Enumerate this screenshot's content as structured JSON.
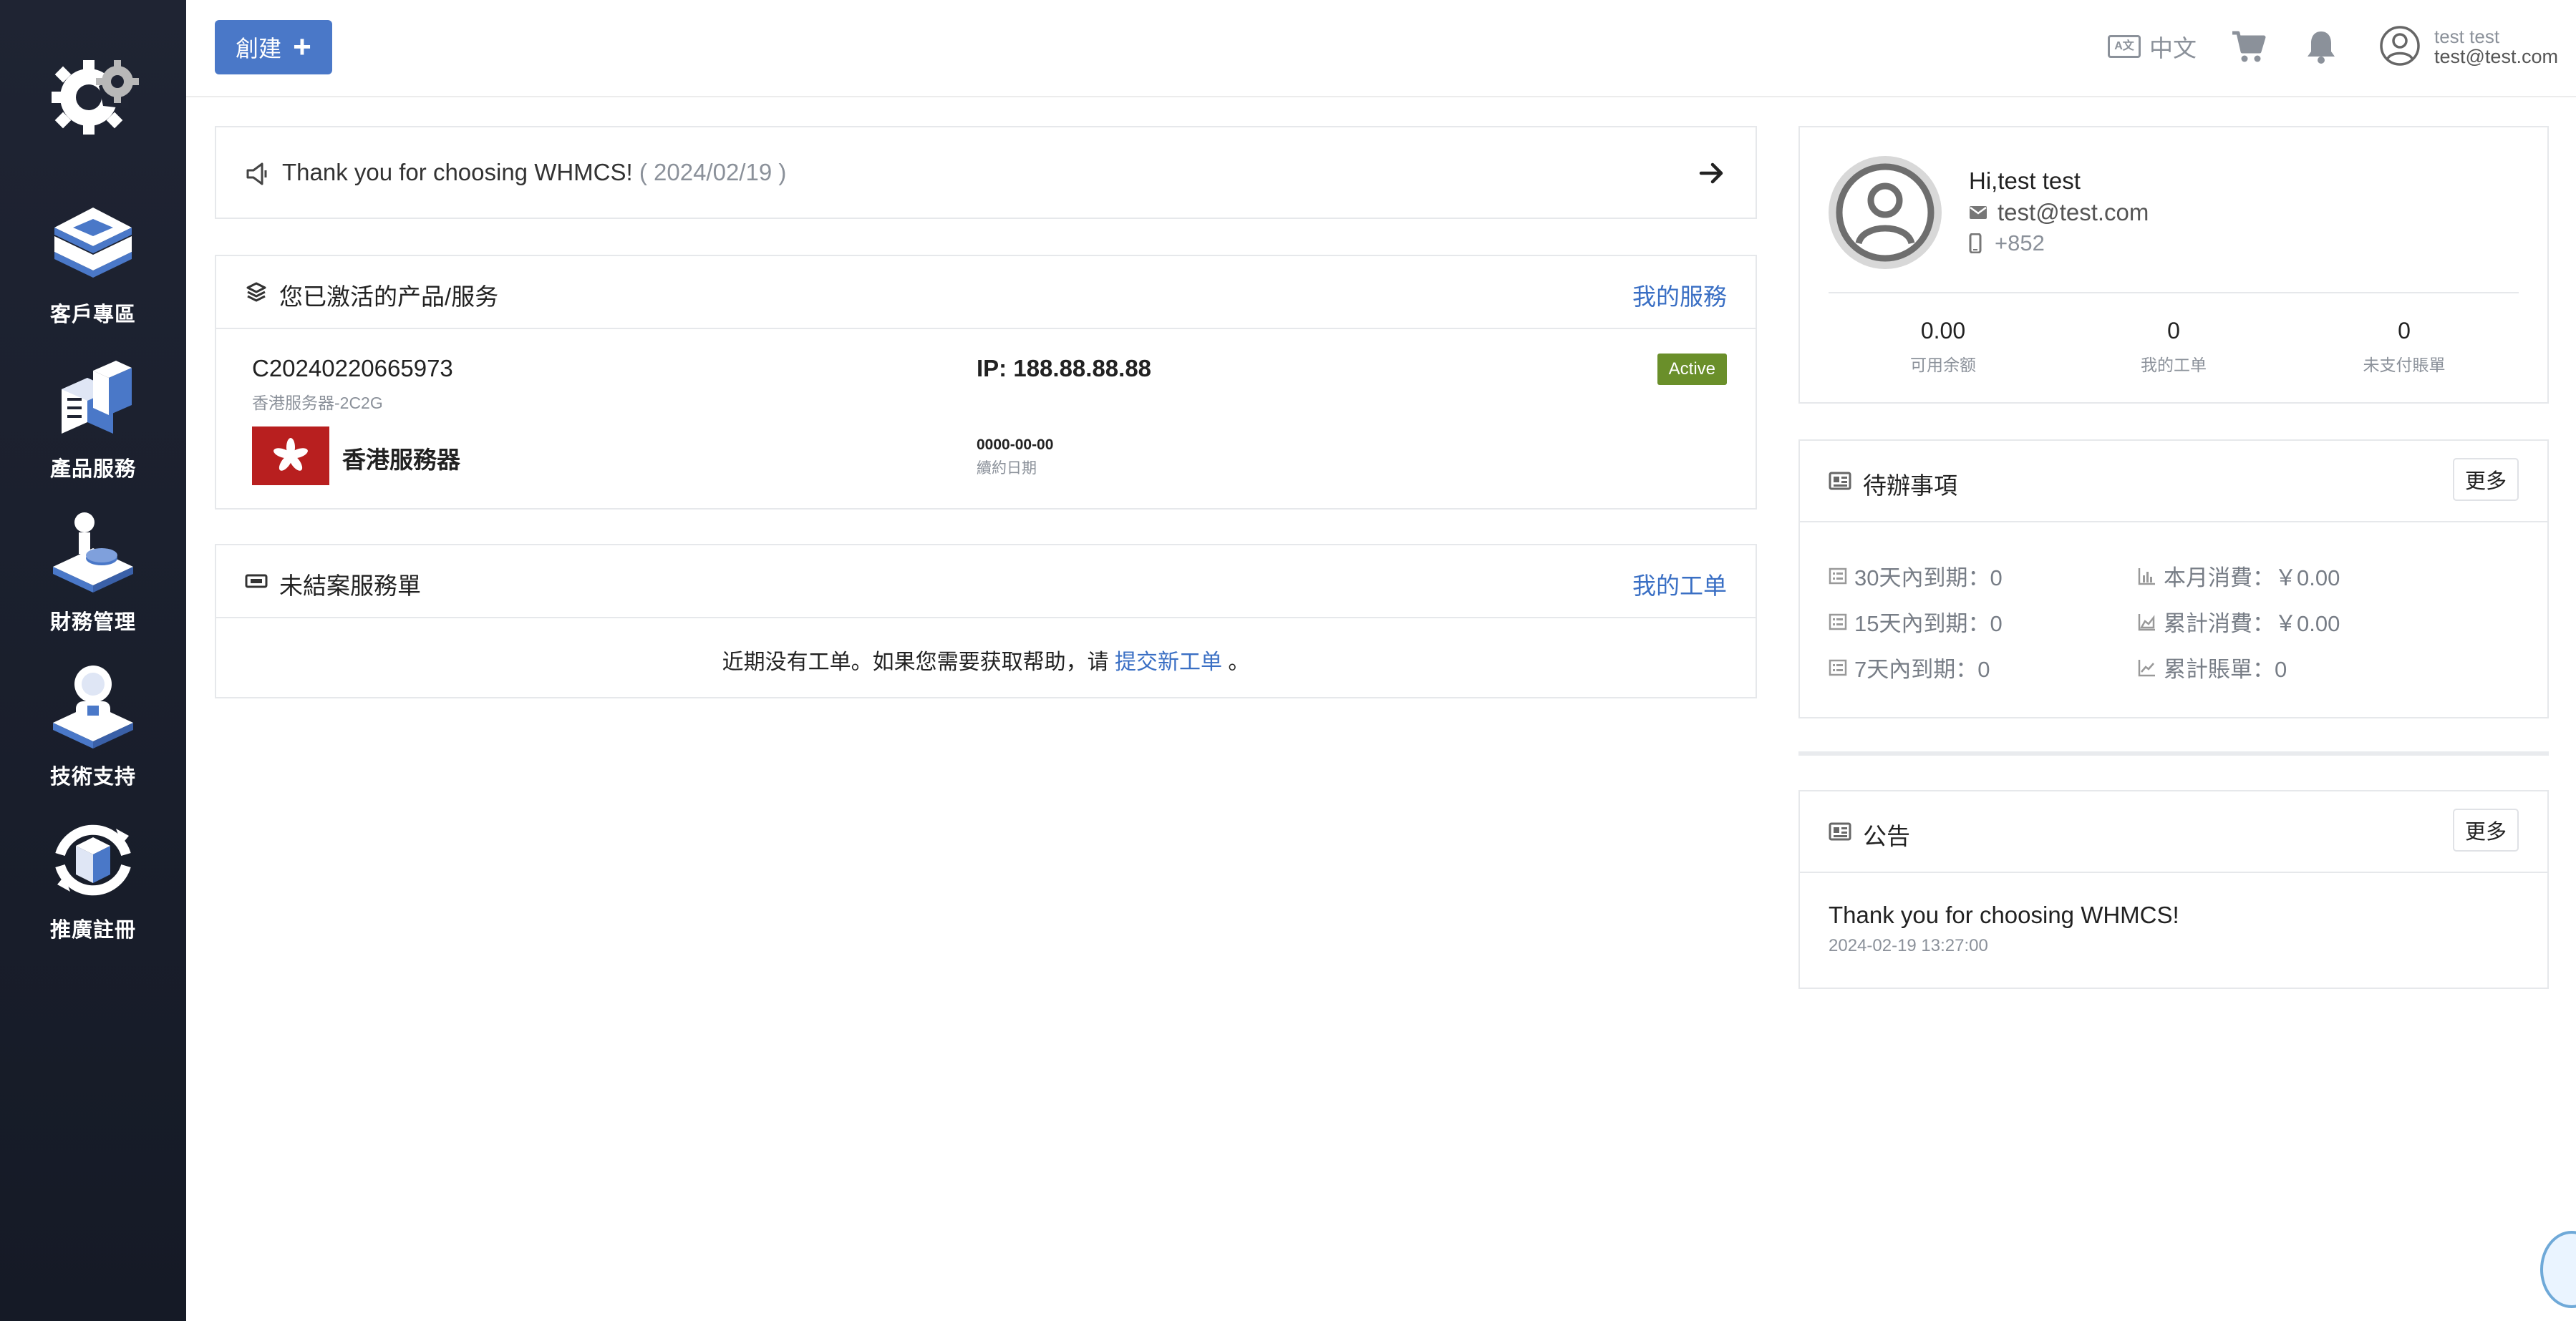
{
  "sidebar": {
    "items": [
      {
        "label": "客戶專區",
        "icon": "stacked-layers-icon"
      },
      {
        "label": "產品服務",
        "icon": "server-cubes-icon"
      },
      {
        "label": "財務管理",
        "icon": "finance-icon"
      },
      {
        "label": "技術支持",
        "icon": "support-agent-icon"
      },
      {
        "label": "推廣註冊",
        "icon": "referral-icon"
      }
    ]
  },
  "header": {
    "create_label": "創建",
    "language": "中文",
    "user_name": "test test",
    "user_email": "test@test.com"
  },
  "notice": {
    "text": "Thank you for choosing WHMCS!",
    "date": "( 2024/02/19 )"
  },
  "services": {
    "title": "您已激活的产品/服务",
    "link": "我的服務",
    "item": {
      "id": "C20240220665973",
      "plan": "香港服务器-2C2G",
      "name": "香港服務器",
      "ip": "IP: 188.88.88.88",
      "date": "0000-00-00",
      "date_label": "續約日期",
      "status": "Active"
    }
  },
  "tickets": {
    "title": "未結案服務單",
    "link": "我的工单",
    "empty_text": "近期没有工单。如果您需要获取帮助，请",
    "empty_link": "提交新工单",
    "empty_end": "。"
  },
  "profile": {
    "greeting": "Hi,test test",
    "email": "test@test.com",
    "phone": "+852",
    "stats": [
      {
        "value": "0.00",
        "label": "可用余额"
      },
      {
        "value": "0",
        "label": "我的工单"
      },
      {
        "value": "0",
        "label": "未支付賬單"
      }
    ]
  },
  "todo": {
    "title": "待辦事項",
    "more": "更多",
    "items": [
      "30天內到期：0",
      "15天內到期：0",
      "7天內到期：0",
      "本月消費：￥0.00",
      "累計消費：￥0.00",
      "累計賬單：0"
    ]
  },
  "announcements": {
    "title": "公告",
    "more": "更多",
    "item_title": "Thank you for choosing WHMCS!",
    "item_date": "2024-02-19 13:27:00"
  },
  "colors": {
    "accent": "#4a78c8",
    "link": "#3a6fc4",
    "status_active": "#6a8f2a",
    "sidebar_bg": "#1f2433"
  }
}
